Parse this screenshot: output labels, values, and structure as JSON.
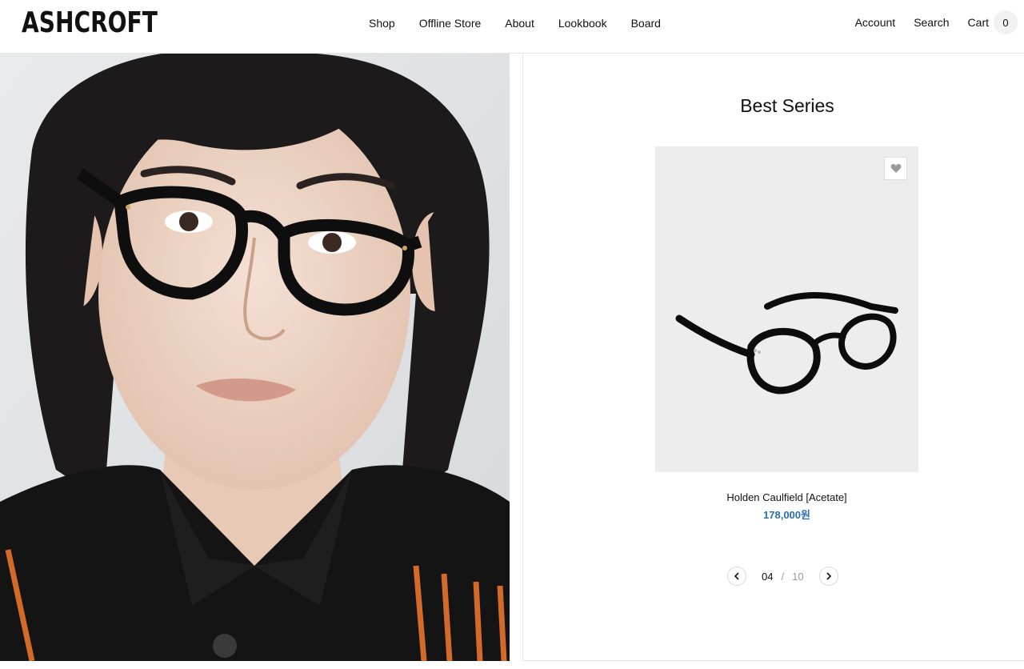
{
  "brand": {
    "logo": "ASHCROFT"
  },
  "nav": {
    "items": [
      "Shop",
      "Offline Store",
      "About",
      "Lookbook",
      "Board"
    ]
  },
  "util": {
    "account": "Account",
    "search": "Search",
    "cart": "Cart",
    "cart_count": "0"
  },
  "section": {
    "title": "Best Series"
  },
  "product": {
    "name": "Holden Caulfield [Acetate]",
    "price": "178,000원"
  },
  "pager": {
    "current": "04",
    "separator": "/",
    "total": "10"
  },
  "colors": {
    "price": "#2a6fb0",
    "card_bg": "#ededed",
    "hero_bg": "#e2e4e6"
  }
}
